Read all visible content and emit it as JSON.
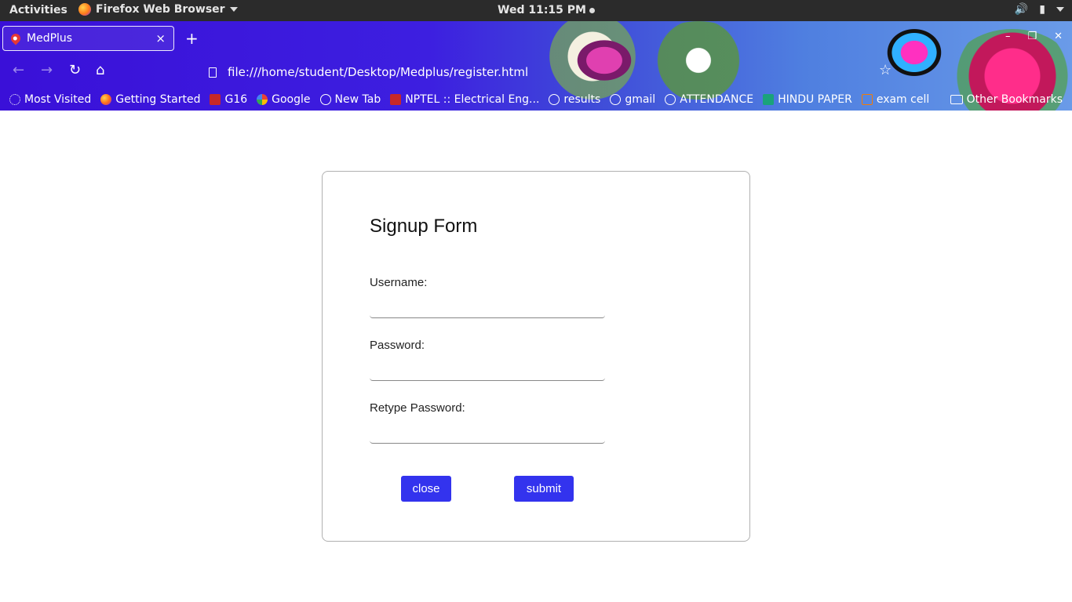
{
  "topbar": {
    "activities": "Activities",
    "app_name": "Firefox Web Browser",
    "clock": "Wed 11:15 PM"
  },
  "browser": {
    "tab_title": "MedPlus",
    "tab_close": "×",
    "new_tab": "+",
    "url": "file:///home/student/Desktop/Medplus/register.html",
    "window_controls": {
      "minimize": "–",
      "maximize": "❐",
      "close": "✕"
    },
    "bookmarks": [
      {
        "label": "Most Visited",
        "icon": "gear-icon"
      },
      {
        "label": "Getting Started",
        "icon": "firefox-icon"
      },
      {
        "label": "G16",
        "icon": "site-icon"
      },
      {
        "label": "Google",
        "icon": "google-icon"
      },
      {
        "label": "New Tab",
        "icon": "globe-icon"
      },
      {
        "label": "NPTEL :: Electrical Eng...",
        "icon": "nptel-icon"
      },
      {
        "label": "results",
        "icon": "globe-icon"
      },
      {
        "label": "gmail",
        "icon": "globe-icon"
      },
      {
        "label": "ATTENDANCE",
        "icon": "globe-icon"
      },
      {
        "label": "HINDU PAPER",
        "icon": "graduation-icon"
      },
      {
        "label": "exam cell",
        "icon": "site-icon"
      }
    ],
    "other_bookmarks": "Other Bookmarks"
  },
  "form": {
    "title": "Signup Form",
    "username_label": "Username:",
    "username_value": "",
    "password_label": "Password:",
    "password_value": "",
    "retype_label": "Retype Password:",
    "retype_value": "",
    "close_label": "close",
    "submit_label": "submit"
  },
  "colors": {
    "button_bg": "#3333ee",
    "button_text": "#ffffff",
    "card_border": "#b0b0b0"
  }
}
